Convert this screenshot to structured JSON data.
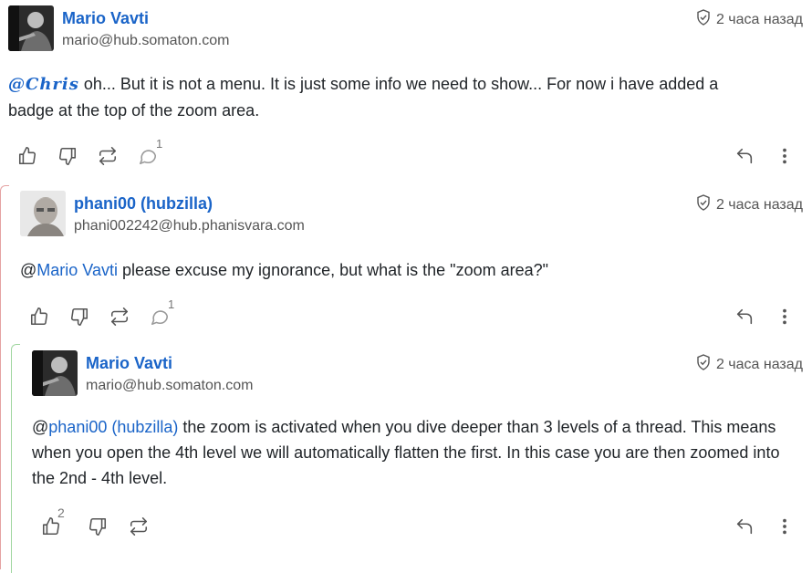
{
  "posts": [
    {
      "author": "Mario Vavti",
      "handle": "mario@hub.somaton.com",
      "time": "2 часа назад",
      "mention": "@Chris",
      "text": " oh... But it is not a menu. It is just some info we need to show... For now i have added a badge at the top of the zoom area.",
      "comments": "1"
    },
    {
      "author": "phani00 (hubzilla)",
      "handle": "phani002242@hub.phanisvara.com",
      "time": "2 часа назад",
      "at": "@",
      "mention": "Mario Vavti",
      "text": " please excuse my ignorance, but what is the \"zoom area?\"",
      "comments": "1"
    },
    {
      "author": "Mario Vavti",
      "handle": "mario@hub.somaton.com",
      "time": "2 часа назад",
      "at": "@",
      "mention": "phani00 (hubzilla)",
      "text": " the zoom is activated when you dive deeper than 3 levels of a thread. This means when you open the 4th level we will automatically flatten the first. In this case you are then zoomed into the 2nd - 4th level.",
      "likes": "2"
    }
  ],
  "icons": {
    "like": "thumbs-up-icon",
    "dislike": "thumbs-down-icon",
    "repeat": "repeat-icon",
    "comment": "comment-icon",
    "reply": "reply-icon",
    "more": "more-vertical-icon",
    "verified": "shield-check-icon"
  },
  "colors": {
    "link": "#1a64c8",
    "text": "#212529",
    "muted": "#555555",
    "thread_red": "#e5a3a3",
    "thread_green": "#9fd69f"
  }
}
